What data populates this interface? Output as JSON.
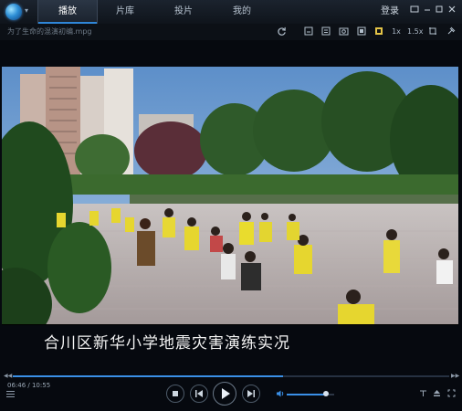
{
  "topbar": {
    "tabs": [
      {
        "label": "播放",
        "active": true
      },
      {
        "label": "片库",
        "active": false
      },
      {
        "label": "投片",
        "active": false
      },
      {
        "label": "我的",
        "active": false
      }
    ],
    "login_label": "登录",
    "window_buttons": [
      "▢",
      "—",
      "□",
      "✕"
    ]
  },
  "toolrow": {
    "filename": "为了生命的混演初编.mpg",
    "icons": [
      "refresh-icon",
      "subtitle-icon",
      "playlist-icon",
      "screenshot-icon",
      "window-icon",
      "bookmark-icon",
      "speed-icon",
      "speed-icon",
      "crop-icon",
      "pin-icon"
    ],
    "speed1": "1x",
    "speed2": "1.5x"
  },
  "video": {
    "subtitle": "合川区新华小学地震灾害演练实况"
  },
  "playback": {
    "time": "06:46 / 10:55",
    "progress_fraction": 0.62,
    "volume_fraction": 0.82
  },
  "colors": {
    "accent": "#3a8fe6",
    "background": "#06090f"
  }
}
